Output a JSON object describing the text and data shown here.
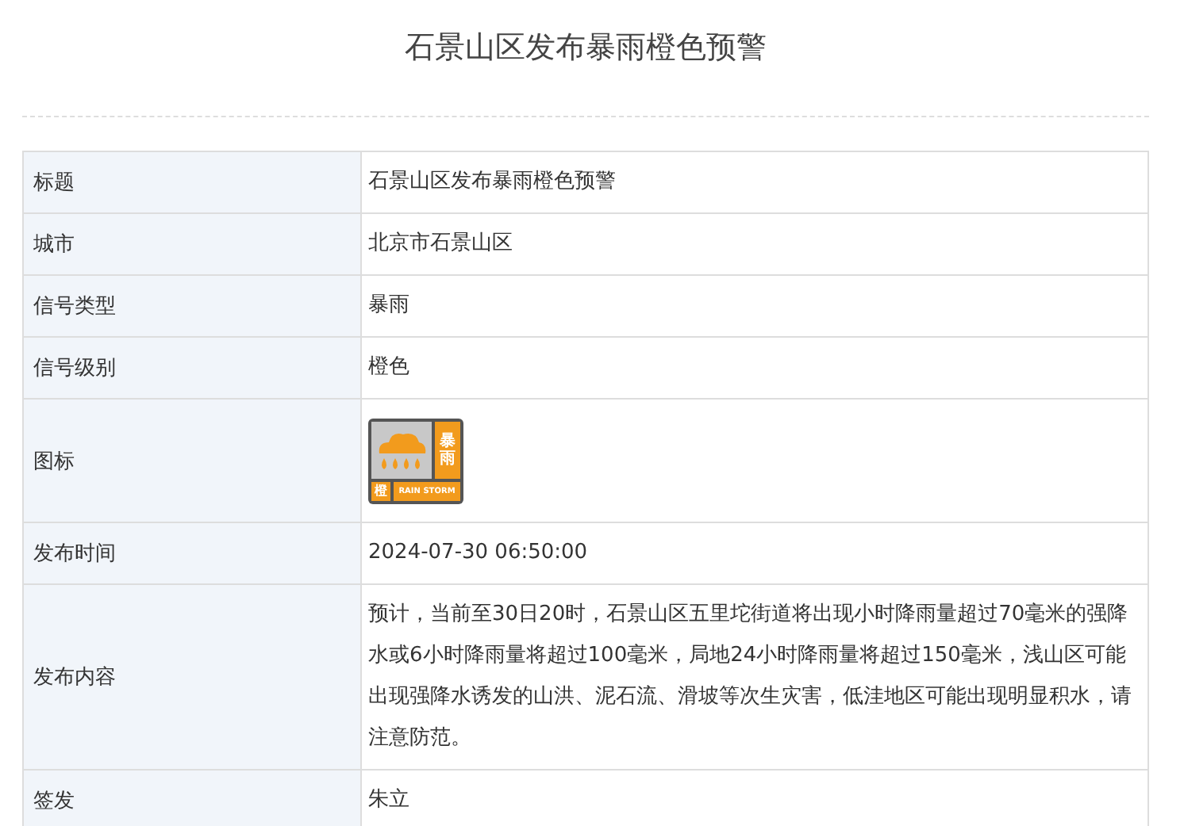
{
  "title": "石景山区发布暴雨橙色预警",
  "rows": [
    {
      "label": "标题",
      "kind": "text",
      "value": "石景山区发布暴雨橙色预警"
    },
    {
      "label": "城市",
      "kind": "text",
      "value": "北京市石景山区"
    },
    {
      "label": "信号类型",
      "kind": "text",
      "value": "暴雨"
    },
    {
      "label": "信号级别",
      "kind": "text",
      "value": "橙色"
    },
    {
      "label": "图标",
      "kind": "icon",
      "icon": {
        "type_text": "暴雨",
        "level_text": "橙",
        "caption": "RAIN STORM",
        "color": "#f29b1d"
      }
    },
    {
      "label": "发布时间",
      "kind": "text",
      "value": "2024-07-30 06:50:00"
    },
    {
      "label": "发布内容",
      "kind": "text",
      "value": "预计，当前至30日20时，石景山区五里坨街道将出现小时降雨量超过70毫米的强降水或6小时降雨量将超过100毫米，局地24小时降雨量将超过150毫米，浅山区可能出现强降水诱发的山洪、泥石流、滑坡等次生灾害，低洼地区可能出现明显积水，请注意防范。"
    },
    {
      "label": "签发",
      "kind": "text",
      "value": "朱立"
    }
  ]
}
